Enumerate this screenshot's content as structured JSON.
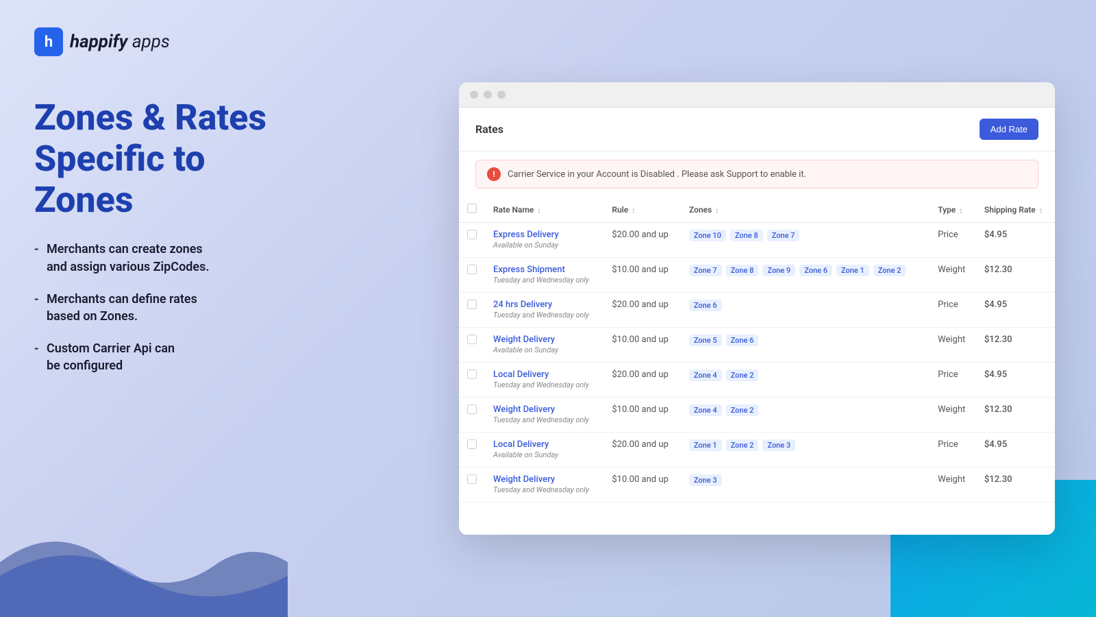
{
  "logo": {
    "icon_letter": "h",
    "brand_name": "happify",
    "brand_suffix": "apps"
  },
  "headline": "Zones & Rates\nSpecific to\nZones",
  "bullets": [
    {
      "text": "Merchants can create zones and assign various ZipCodes."
    },
    {
      "text": "Merchants can define rates based on Zones."
    },
    {
      "text": "Custom Carrier Api can be configured"
    }
  ],
  "browser": {
    "page_title": "Rates",
    "add_rate_label": "Add Rate",
    "alert_message": "Carrier Service in your Account is Disabled . Please ask Support to enable it.",
    "table": {
      "columns": [
        "Rate Name",
        "Rule",
        "Zones",
        "Type",
        "Shipping Rate"
      ],
      "rows": [
        {
          "name": "Express Delivery",
          "sub": "Available on Sunday",
          "rule": "$20.00 and up",
          "zones": [
            "Zone 10",
            "Zone 8",
            "Zone 7"
          ],
          "type": "Price",
          "rate": "$4.95"
        },
        {
          "name": "Express Shipment",
          "sub": "Tuesday and Wednesday only",
          "rule": "$10.00 and up",
          "zones": [
            "Zone 7",
            "Zone 8",
            "Zone 9",
            "Zone 6",
            "Zone 1",
            "Zone 2"
          ],
          "type": "Weight",
          "rate": "$12.30"
        },
        {
          "name": "24 hrs Delivery",
          "sub": "Tuesday and Wednesday only",
          "rule": "$20.00 and up",
          "zones": [
            "Zone 6"
          ],
          "type": "Price",
          "rate": "$4.95"
        },
        {
          "name": "Weight Delivery",
          "sub": "Available on Sunday",
          "rule": "$10.00 and up",
          "zones": [
            "Zone 5",
            "Zone 6"
          ],
          "type": "Weight",
          "rate": "$12.30"
        },
        {
          "name": "Local Delivery",
          "sub": "Tuesday and Wednesday only",
          "rule": "$20.00 and up",
          "zones": [
            "Zone 4",
            "Zone 2"
          ],
          "type": "Price",
          "rate": "$4.95"
        },
        {
          "name": "Weight Delivery",
          "sub": "Tuesday and Wednesday only",
          "rule": "$10.00 and up",
          "zones": [
            "Zone 4",
            "Zone 2"
          ],
          "type": "Weight",
          "rate": "$12.30"
        },
        {
          "name": "Local Delivery",
          "sub": "Available on Sunday",
          "rule": "$20.00 and up",
          "zones": [
            "Zone 1",
            "Zone 2",
            "Zone 3"
          ],
          "type": "Price",
          "rate": "$4.95"
        },
        {
          "name": "Weight Delivery",
          "sub": "Tuesday and Wednesday only",
          "rule": "$10.00 and up",
          "zones": [
            "Zone 3"
          ],
          "type": "Weight",
          "rate": "$12.30"
        }
      ]
    }
  }
}
